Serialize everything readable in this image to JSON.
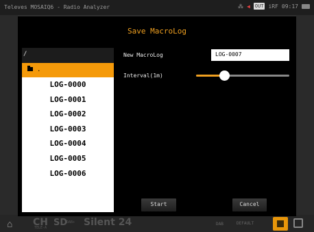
{
  "topbar": {
    "title": "Televes MOSAIQ6 - Radio Analyzer",
    "out_label": "OUT",
    "rf_label": "iRF",
    "time": "09:17"
  },
  "dialog": {
    "title": "Save MacroLog",
    "browser": {
      "path": "/",
      "folder_label": ".",
      "files": [
        "LOG-0000",
        "LOG-0001",
        "LOG-0002",
        "LOG-0003",
        "LOG-0004",
        "LOG-0005",
        "LOG-0006"
      ]
    },
    "name_label": "New MacroLog",
    "name_value": "LOG-0007",
    "interval_label": "Interval(1m)",
    "interval_level": 0.3,
    "start_label": "Start",
    "cancel_label": "Cancel"
  },
  "bottombar": {
    "channel": "CH",
    "channel_sub": "TELE-A",
    "format": "SD",
    "format_sub": "DAB+",
    "service": "Silent 24",
    "dab_label": "DAB",
    "default_label": "DEFAULT"
  },
  "colors": {
    "accent": "#f0a020",
    "selection": "#f59a0a",
    "dialog_bg": "#000000"
  }
}
